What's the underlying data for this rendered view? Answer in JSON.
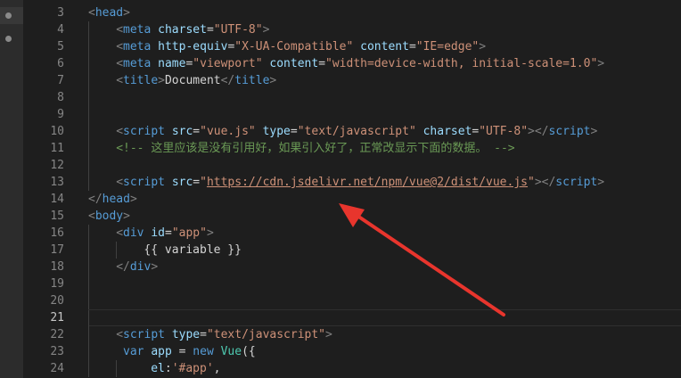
{
  "editor": {
    "activity_items": [
      {
        "name": "explorer-dot-icon",
        "selected": true
      },
      {
        "name": "outline-dot-icon",
        "selected": false
      }
    ],
    "active_line": "21",
    "lines": [
      {
        "number": "3",
        "indent": 0,
        "tokens": [
          [
            "bracket",
            "<"
          ],
          [
            "tag",
            "head"
          ],
          [
            "bracket",
            ">"
          ]
        ]
      },
      {
        "number": "4",
        "indent": 1,
        "tokens": [
          [
            "bracket",
            "<"
          ],
          [
            "tag",
            "meta"
          ],
          [
            "text",
            " "
          ],
          [
            "attr",
            "charset"
          ],
          [
            "text",
            "="
          ],
          [
            "str",
            "\"UTF-8\""
          ],
          [
            "bracket",
            ">"
          ]
        ]
      },
      {
        "number": "5",
        "indent": 1,
        "tokens": [
          [
            "bracket",
            "<"
          ],
          [
            "tag",
            "meta"
          ],
          [
            "text",
            " "
          ],
          [
            "attr",
            "http-equiv"
          ],
          [
            "text",
            "="
          ],
          [
            "str",
            "\"X-UA-Compatible\""
          ],
          [
            "text",
            " "
          ],
          [
            "attr",
            "content"
          ],
          [
            "text",
            "="
          ],
          [
            "str",
            "\"IE=edge\""
          ],
          [
            "bracket",
            ">"
          ]
        ]
      },
      {
        "number": "6",
        "indent": 1,
        "tokens": [
          [
            "bracket",
            "<"
          ],
          [
            "tag",
            "meta"
          ],
          [
            "text",
            " "
          ],
          [
            "attr",
            "name"
          ],
          [
            "text",
            "="
          ],
          [
            "str",
            "\"viewport\""
          ],
          [
            "text",
            " "
          ],
          [
            "attr",
            "content"
          ],
          [
            "text",
            "="
          ],
          [
            "str",
            "\"width=device-width, initial-scale=1.0\""
          ],
          [
            "bracket",
            ">"
          ]
        ]
      },
      {
        "number": "7",
        "indent": 1,
        "tokens": [
          [
            "bracket",
            "<"
          ],
          [
            "tag",
            "title"
          ],
          [
            "bracket",
            ">"
          ],
          [
            "text",
            "Document"
          ],
          [
            "bracket",
            "</"
          ],
          [
            "tag",
            "title"
          ],
          [
            "bracket",
            ">"
          ]
        ]
      },
      {
        "number": "8",
        "indent": 1,
        "tokens": []
      },
      {
        "number": "9",
        "indent": 1,
        "tokens": []
      },
      {
        "number": "10",
        "indent": 1,
        "tokens": [
          [
            "bracket",
            "<"
          ],
          [
            "tag",
            "script"
          ],
          [
            "text",
            " "
          ],
          [
            "attr",
            "src"
          ],
          [
            "text",
            "="
          ],
          [
            "str",
            "\"vue.js\""
          ],
          [
            "text",
            " "
          ],
          [
            "attr",
            "type"
          ],
          [
            "text",
            "="
          ],
          [
            "str",
            "\"text/javascript\""
          ],
          [
            "text",
            " "
          ],
          [
            "attr",
            "charset"
          ],
          [
            "text",
            "="
          ],
          [
            "str",
            "\"UTF-8\""
          ],
          [
            "bracket",
            "></"
          ],
          [
            "tag",
            "script"
          ],
          [
            "bracket",
            ">"
          ]
        ]
      },
      {
        "number": "11",
        "indent": 1,
        "tokens": [
          [
            "comment",
            "<!-- 这里应该是没有引用好，如果引入好了，正常改显示下面的数据。 -->"
          ]
        ]
      },
      {
        "number": "12",
        "indent": 1,
        "tokens": []
      },
      {
        "number": "13",
        "indent": 1,
        "tokens": [
          [
            "bracket",
            "<"
          ],
          [
            "tag",
            "script"
          ],
          [
            "text",
            " "
          ],
          [
            "attr",
            "src"
          ],
          [
            "text",
            "="
          ],
          [
            "str",
            "\""
          ],
          [
            "link",
            "https://cdn.jsdelivr.net/npm/vue@2/dist/vue.js"
          ],
          [
            "str",
            "\""
          ],
          [
            "bracket",
            "></"
          ],
          [
            "tag",
            "script"
          ],
          [
            "bracket",
            ">"
          ]
        ]
      },
      {
        "number": "14",
        "indent": 0,
        "tokens": [
          [
            "bracket",
            "</"
          ],
          [
            "tag",
            "head"
          ],
          [
            "bracket",
            ">"
          ]
        ]
      },
      {
        "number": "15",
        "indent": 0,
        "tokens": [
          [
            "bracket",
            "<"
          ],
          [
            "tag",
            "body"
          ],
          [
            "bracket",
            ">"
          ]
        ]
      },
      {
        "number": "16",
        "indent": 1,
        "tokens": [
          [
            "bracket",
            "<"
          ],
          [
            "tag",
            "div"
          ],
          [
            "text",
            " "
          ],
          [
            "attr",
            "id"
          ],
          [
            "text",
            "="
          ],
          [
            "str",
            "\"app\""
          ],
          [
            "bracket",
            ">"
          ]
        ]
      },
      {
        "number": "17",
        "indent": 2,
        "tokens": [
          [
            "text",
            "{{ variable }}"
          ]
        ]
      },
      {
        "number": "18",
        "indent": 1,
        "tokens": [
          [
            "bracket",
            "</"
          ],
          [
            "tag",
            "div"
          ],
          [
            "bracket",
            ">"
          ]
        ]
      },
      {
        "number": "19",
        "indent": 1,
        "tokens": []
      },
      {
        "number": "20",
        "indent": 1,
        "tokens": []
      },
      {
        "number": "21",
        "indent": 1,
        "tokens": []
      },
      {
        "number": "22",
        "indent": 1,
        "tokens": [
          [
            "bracket",
            "<"
          ],
          [
            "tag",
            "script"
          ],
          [
            "text",
            " "
          ],
          [
            "attr",
            "type"
          ],
          [
            "text",
            "="
          ],
          [
            "str",
            "\"text/javascript\""
          ],
          [
            "bracket",
            ">"
          ]
        ]
      },
      {
        "number": "23",
        "indent": 1,
        "tokens": [
          [
            "text",
            " "
          ],
          [
            "kw",
            "var"
          ],
          [
            "text",
            " "
          ],
          [
            "var",
            "app"
          ],
          [
            "text",
            " = "
          ],
          [
            "kw",
            "new"
          ],
          [
            "text",
            " "
          ],
          [
            "cls",
            "Vue"
          ],
          [
            "text",
            "({"
          ]
        ]
      },
      {
        "number": "24",
        "indent": 2,
        "tokens": [
          [
            "text",
            " "
          ],
          [
            "var",
            "el"
          ],
          [
            "text",
            ":"
          ],
          [
            "str",
            "'#app'"
          ],
          [
            "text",
            ","
          ]
        ]
      }
    ]
  },
  "colors": {
    "background": "#1e1e1e",
    "annotation_arrow": "#e8352d"
  },
  "annotation": {
    "icon": "red-arrow-icon"
  }
}
